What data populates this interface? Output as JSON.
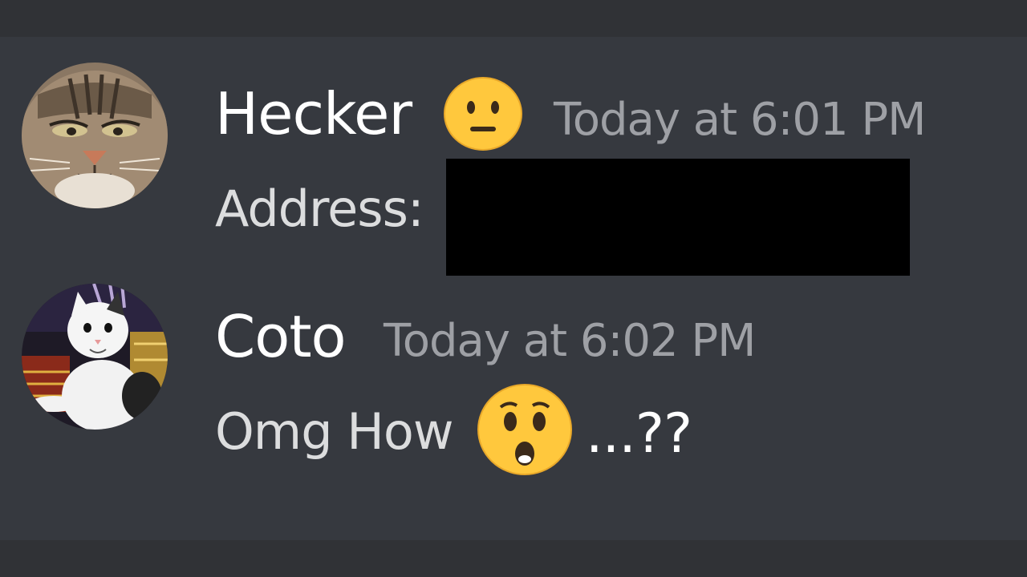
{
  "messages": [
    {
      "username": "Hecker",
      "timestamp": "Today at 6:01 PM",
      "text": "Address:",
      "status_emoji": "neutral-face",
      "redacted": true
    },
    {
      "username": "Coto",
      "timestamp": "Today at 6:02 PM",
      "text": "Omg How",
      "text_after": "...??",
      "reaction_emoji": "hushed-face"
    }
  ],
  "colors": {
    "background": "#36393f",
    "username": "#ffffff",
    "timestamp": "#9ea0a5",
    "message": "#dcddde",
    "emoji": "#ffc83d"
  }
}
